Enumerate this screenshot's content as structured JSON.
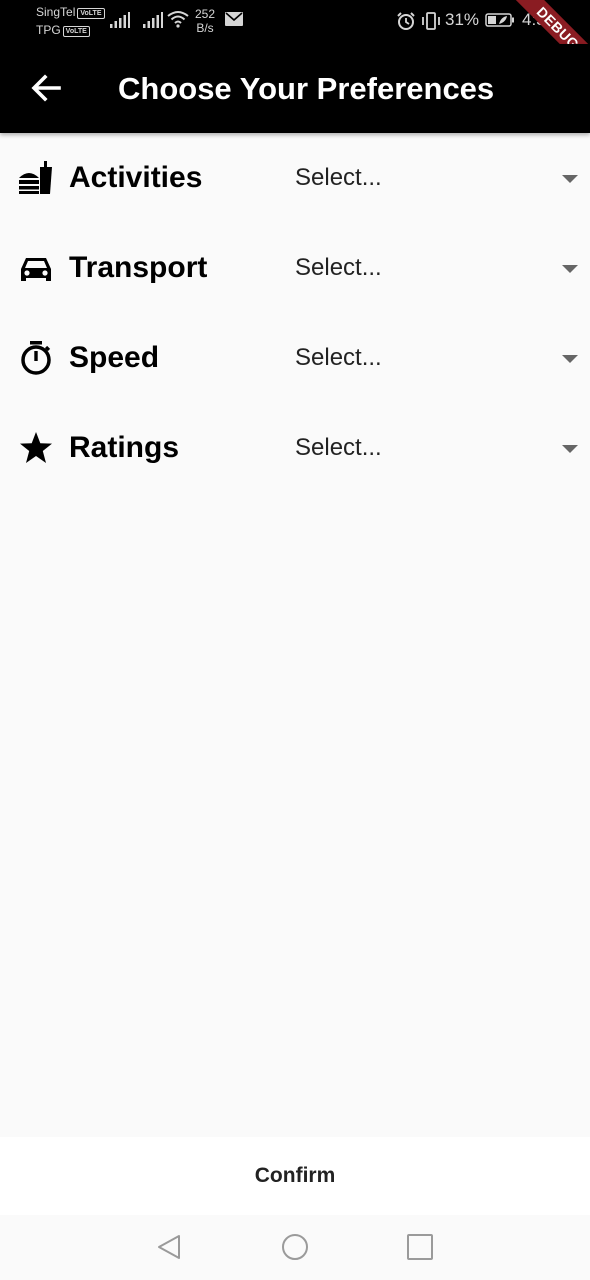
{
  "status_bar": {
    "carrier1": "SingTel",
    "carrier2": "TPG",
    "volte_badge": "VoLTE",
    "net_speed_value": "252",
    "net_speed_unit": "B/s",
    "battery_percent": "31%",
    "time": "4:58",
    "debug_banner": "DEBUG"
  },
  "app_bar": {
    "title": "Choose Your Preferences",
    "back_icon": "arrow-back-icon"
  },
  "preferences": [
    {
      "label": "Activities",
      "icon": "fastfood-icon",
      "value": "Select..."
    },
    {
      "label": "Transport",
      "icon": "car-icon",
      "value": "Select..."
    },
    {
      "label": "Speed",
      "icon": "timer-icon",
      "value": "Select..."
    },
    {
      "label": "Ratings",
      "icon": "star-icon",
      "value": "Select..."
    }
  ],
  "confirm": {
    "label": "Confirm"
  },
  "nav_bar": {
    "back": "nav-back-icon",
    "home": "nav-home-icon",
    "recents": "nav-recents-icon"
  }
}
